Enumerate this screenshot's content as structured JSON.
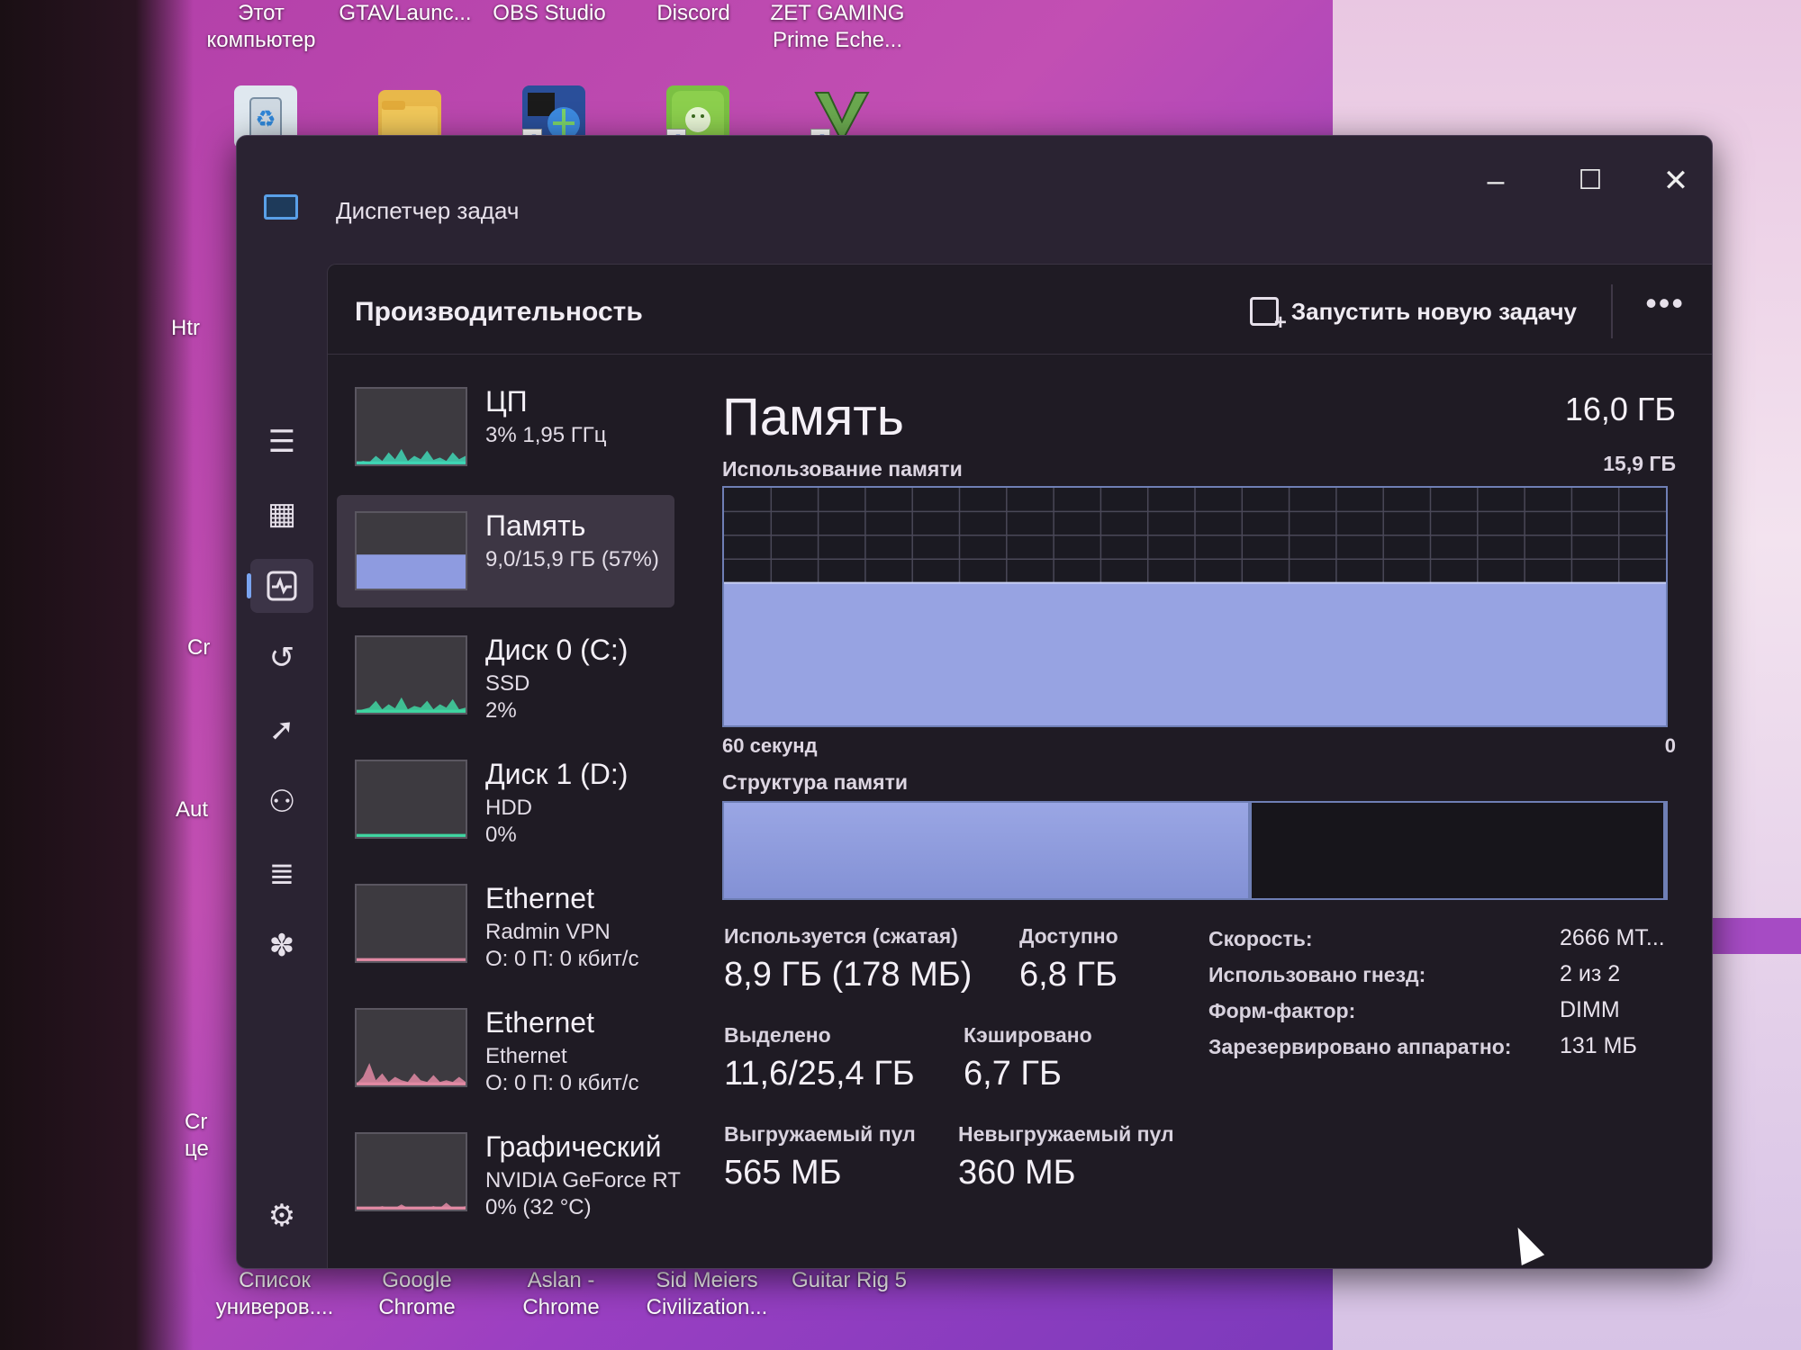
{
  "desktop": {
    "top_labels": [
      {
        "line1": "Этот",
        "line2": "компьютер"
      },
      {
        "line1": "GTAVLaunc...",
        "line2": ""
      },
      {
        "line1": "OBS Studio",
        "line2": ""
      },
      {
        "line1": "Discord",
        "line2": ""
      },
      {
        "line1": "ZET GAMING",
        "line2": "Prime Eche..."
      }
    ],
    "side_fragments": [
      "Htr",
      "Cr",
      "Aut",
      "Cr",
      "це"
    ],
    "bottom_labels": [
      {
        "line1": "Список",
        "line2": "универов...."
      },
      {
        "line1": "Google",
        "line2": "Chrome"
      },
      {
        "line1": "Aslan -",
        "line2": "Chrome"
      },
      {
        "line1": "Sid Meiers",
        "line2": "Civilization..."
      },
      {
        "line1": "Guitar Rig 5",
        "line2": ""
      }
    ],
    "icon_colors": [
      "#3a8fd6",
      "#e6b23c",
      "#2a6bd1",
      "#7bc043",
      "#6aa84f"
    ]
  },
  "window": {
    "title": "Диспетчер задач",
    "controls": {
      "minimize": "–",
      "maximize": "☐",
      "close": "✕"
    },
    "nav_icons": [
      "hamburger-icon",
      "processes-icon",
      "performance-icon",
      "history-icon",
      "startup-icon",
      "users-icon",
      "details-icon",
      "services-icon",
      "settings-icon"
    ]
  },
  "header": {
    "page_title": "Производительность",
    "run_task_label": "Запустить новую задачу",
    "more_label": "•••"
  },
  "resources": [
    {
      "name": "ЦП",
      "sub1": "3% 1,95 ГГц",
      "sub2": "",
      "color": "#3fd6b5",
      "selected": false
    },
    {
      "name": "Память",
      "sub1": "9,0/15,9 ГБ (57%)",
      "sub2": "",
      "color": "#8e9be0",
      "selected": true
    },
    {
      "name": "Диск 0 (C:)",
      "sub1": "SSD",
      "sub2": "2%",
      "color": "#3fd6a2",
      "selected": false
    },
    {
      "name": "Диск 1 (D:)",
      "sub1": "HDD",
      "sub2": "0%",
      "color": "#3fd6a2",
      "selected": false
    },
    {
      "name": "Ethernet",
      "sub1": "Radmin VPN",
      "sub2": "О: 0 П: 0 кбит/с",
      "color": "#e28aa4",
      "selected": false
    },
    {
      "name": "Ethernet",
      "sub1": "Ethernet",
      "sub2": "О: 0 П: 0 кбит/с",
      "color": "#e28aa4",
      "selected": false
    },
    {
      "name": "Графический",
      "sub1": "NVIDIA GeForce RT",
      "sub2": "0% (32 °C)",
      "color": "#e28aa4",
      "selected": false
    }
  ],
  "memory": {
    "title": "Память",
    "total": "16,0 ГБ",
    "usage_label": "Использование памяти",
    "usage_max": "15,9 ГБ",
    "usage_fraction": 0.57,
    "time_left": "60 секунд",
    "time_right": "0",
    "composition_label": "Структура памяти",
    "composition_used_fraction": 0.56,
    "stats": [
      {
        "label": "Используется (сжатая)",
        "value": "8,9 ГБ (178 МБ)"
      },
      {
        "label": "Доступно",
        "value": "6,8 ГБ"
      },
      {
        "label": "Выделено",
        "value": "11,6/25,4 ГБ"
      },
      {
        "label": "Кэшировано",
        "value": "6,7 ГБ"
      },
      {
        "label": "Выгружаемый пул",
        "value": "565 МБ"
      },
      {
        "label": "Невыгружаемый пул",
        "value": "360 МБ"
      }
    ],
    "specs": [
      {
        "label": "Скорость:",
        "value": "2666 МТ..."
      },
      {
        "label": "Использовано гнезд:",
        "value": "2 из 2"
      },
      {
        "label": "Форм-фактор:",
        "value": "DIMM"
      },
      {
        "label": "Зарезервировано аппаратно:",
        "value": "131 МБ"
      }
    ]
  }
}
